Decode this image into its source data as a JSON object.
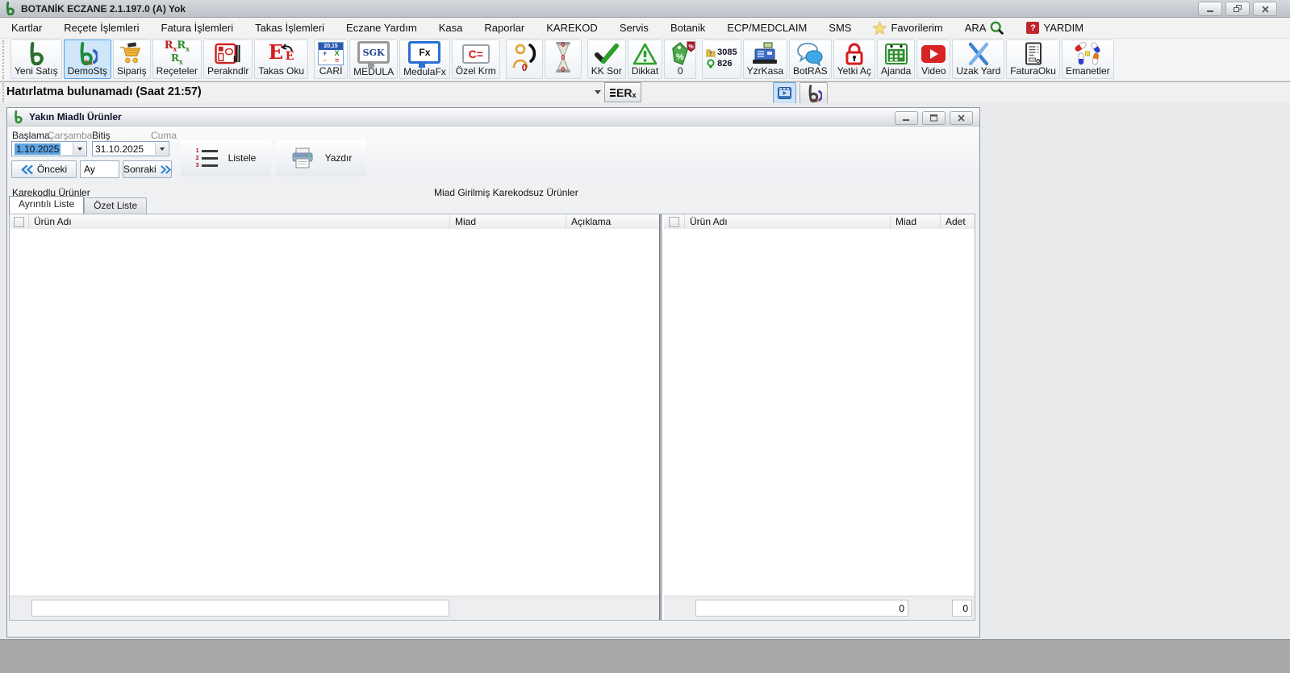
{
  "titlebar": {
    "title": "BOTANİK ECZANE 2.1.197.0 (A) Yok"
  },
  "menu": {
    "items": [
      "Kartlar",
      "Reçete İşlemleri",
      "Fatura İşlemleri",
      "Takas İşlemleri",
      "Eczane Yardım",
      "Kasa",
      "Raporlar",
      "KAREKOD",
      "Servis",
      "Botanik",
      "ECP/MEDCLAIM",
      "SMS"
    ],
    "favorites": "Favorilerim",
    "search_label": "ARA",
    "help_label": "YARDIM"
  },
  "toolbar": {
    "buttons": [
      {
        "icon": "botanik-logo-icon",
        "label": "Yeni Satış"
      },
      {
        "icon": "botanik-demo-logo-icon",
        "label": "DemoStş"
      },
      {
        "icon": "cart-icon",
        "label": "Sipariş"
      },
      {
        "icon": "rx-icon",
        "label": "Reçeteler"
      },
      {
        "icon": "retail-barcode-icon",
        "label": "Perakndlr"
      },
      {
        "icon": "exchange-e-icon",
        "label": "Takas Oku"
      },
      {
        "icon": "calculator-icon",
        "label": "CARİ",
        "icon_text": "20,15"
      },
      {
        "icon": "monitor-sgk-icon",
        "label": "MEDULA",
        "icon_text": "SGK"
      },
      {
        "icon": "monitor-fx-icon",
        "label": "MedulaFx",
        "icon_text": "Fx"
      },
      {
        "icon": "card-icon",
        "label": "Özel Krm",
        "icon_text": "C="
      },
      {
        "icon": "phone-contact-icon",
        "label": "",
        "badge": "0"
      },
      {
        "icon": "hourglass-icon",
        "label": "",
        "badge": "0"
      },
      {
        "icon": "check-icon",
        "label": "KK Sor"
      },
      {
        "icon": "warning-icon",
        "label": "Dikkat"
      },
      {
        "icon": "discount-tag-icon",
        "label": "0"
      },
      {
        "icon": "counter-icon",
        "label": "",
        "count1": "3085",
        "count2": "826"
      },
      {
        "icon": "cash-register-icon",
        "label": "YzrKasa"
      },
      {
        "icon": "chat-icon",
        "label": "BotRAS"
      },
      {
        "icon": "padlock-icon",
        "label": "Yetki Aç"
      },
      {
        "icon": "calendar-icon",
        "label": "Ajanda"
      },
      {
        "icon": "video-icon",
        "label": "Video"
      },
      {
        "icon": "remote-x-icon",
        "label": "Uzak Yard"
      },
      {
        "icon": "invoice-icon",
        "label": "FaturaOku"
      },
      {
        "icon": "pills-icon",
        "label": "Emanetler"
      }
    ]
  },
  "reminderbar": {
    "text": "Hatırlatma bulunamadı (Saat 21:57)",
    "erx_text": "ER",
    "erx_sub": "x"
  },
  "dialog": {
    "title": "Yakın Miadlı Ürünler",
    "filter": {
      "start_label": "Başlama",
      "start_day": "Çarşamba",
      "start_value": "1.10.2025",
      "end_label": "Bitiş",
      "end_day": "Cuma",
      "end_value": "31.10.2025",
      "prev_label": "Önceki",
      "period_value": "Ay",
      "next_label": "Sonraki",
      "list_label": "Listele",
      "print_label": "Yazdır"
    },
    "section_left": "Karekodlu Ürünler",
    "section_right": "Miad Girilmiş Karekodsuz Ürünler",
    "tabs": [
      {
        "label": "Ayrıntılı Liste"
      },
      {
        "label": "Özet Liste"
      }
    ],
    "left_table": {
      "columns": [
        "Ürün Adı",
        "Miad",
        "Açıklama"
      ],
      "rows": [],
      "footer_filter": ""
    },
    "right_table": {
      "columns": [
        "Ürün Adı",
        "Miad",
        "Adet"
      ],
      "rows": [],
      "footer_total": "0",
      "footer_adet": "0"
    }
  },
  "colors": {
    "logo_green": "#2a7d2f",
    "accent_blue": "#2f7fd0",
    "alert_red": "#cc2222",
    "tag_green": "#44a34d",
    "selection_blue": "#5da5e2",
    "desktop_gray": "#a9a9a9"
  }
}
